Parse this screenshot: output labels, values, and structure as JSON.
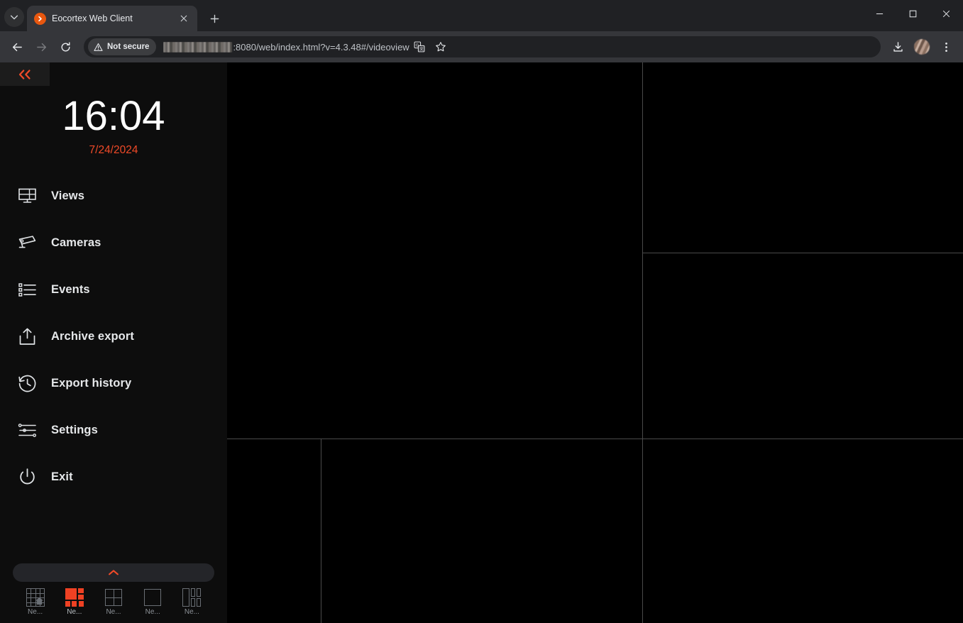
{
  "browser": {
    "tab_search_icon": "chevron-down-icon",
    "tab": {
      "title": "Eocortex Web Client",
      "favicon": "eocortex-logo-icon",
      "close_icon": "close-icon"
    },
    "new_tab_label": "+",
    "window_controls": {
      "minimize": "minimize-icon",
      "maximize": "maximize-icon",
      "close": "close-icon"
    },
    "toolbar": {
      "back_icon": "back-arrow-icon",
      "forward_icon": "forward-arrow-icon",
      "reload_icon": "reload-icon",
      "security_label": "Not secure",
      "security_icon": "warning-triangle-icon",
      "url_redacted": true,
      "url_text": ":8080/web/index.html?v=4.3.48#/videoview",
      "translate_icon": "translate-icon",
      "bookmark_icon": "star-icon",
      "download_icon": "download-icon",
      "profile_icon": "profile-avatar",
      "menu_icon": "three-dot-menu-icon"
    }
  },
  "sidebar": {
    "collapse_icon": "double-chevron-left-icon",
    "clock": {
      "time": "16:04",
      "date": "7/24/2024"
    },
    "nav_items": [
      {
        "label": "Views",
        "icon": "views-monitor-icon"
      },
      {
        "label": "Cameras",
        "icon": "camera-icon"
      },
      {
        "label": "Events",
        "icon": "events-list-icon"
      },
      {
        "label": "Archive export",
        "icon": "upload-export-icon"
      },
      {
        "label": "Export history",
        "icon": "clock-history-icon"
      },
      {
        "label": "Settings",
        "icon": "sliders-icon"
      },
      {
        "label": "Exit",
        "icon": "power-icon"
      }
    ],
    "expand_bar_icon": "chevron-up-icon",
    "layouts": [
      {
        "caption": "Ne...",
        "icon": "grid-4x4-home-icon",
        "active": false,
        "has_home": true
      },
      {
        "caption": "Ne...",
        "icon": "grid-1plus5-icon",
        "active": true,
        "has_home": false
      },
      {
        "caption": "Ne...",
        "icon": "grid-2x2-icon",
        "active": false,
        "has_home": false
      },
      {
        "caption": "Ne...",
        "icon": "grid-1x1-icon",
        "active": false,
        "has_home": false
      },
      {
        "caption": "Ne...",
        "icon": "grid-1plus4-icon",
        "active": false,
        "has_home": false
      }
    ]
  },
  "video_grid": {
    "active_layout": "1 large + 5 cells",
    "cells": [
      {
        "name": "cell-main-large"
      },
      {
        "name": "cell-top-right"
      },
      {
        "name": "cell-middle-right"
      },
      {
        "name": "cell-bottom-left-narrow"
      },
      {
        "name": "cell-bottom-middle"
      },
      {
        "name": "cell-bottom-right"
      }
    ]
  },
  "colors": {
    "accent": "#f04a28",
    "grid_line": "#4a4a4a",
    "sidebar_bg": "#0d0d0d",
    "chrome_bg": "#35363a"
  }
}
